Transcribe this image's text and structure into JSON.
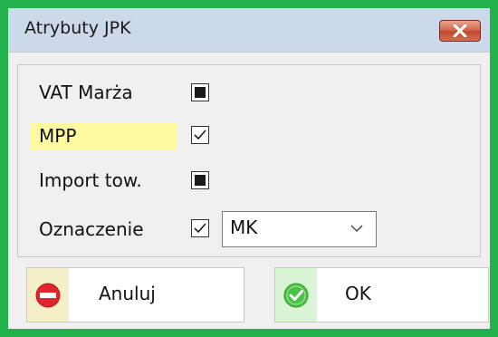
{
  "dialog": {
    "title": "Atrybuty JPK",
    "close_icon": "close-icon",
    "accent_color": "#22b14c",
    "highlight_color": "#fff9a0"
  },
  "fields": [
    {
      "label": "VAT Marża",
      "state": "indeterminate"
    },
    {
      "label": "MPP",
      "state": "checked"
    },
    {
      "label": "Import tow.",
      "state": "indeterminate"
    },
    {
      "label": "Oznaczenie",
      "state": "checked"
    }
  ],
  "oznaczenie_select": {
    "value": "MK",
    "icon": "chevron-down-icon"
  },
  "buttons": {
    "cancel": {
      "label": "Anuluj",
      "icon": "no-entry-icon"
    },
    "ok": {
      "label": "OK",
      "icon": "check-circle-icon"
    }
  }
}
